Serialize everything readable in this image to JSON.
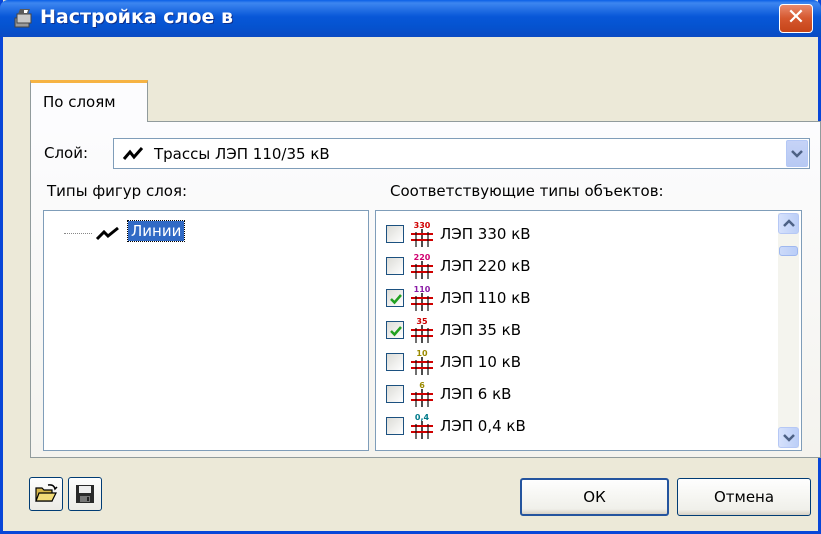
{
  "window": {
    "title": "Настройка слое в",
    "close_symbol": "✕",
    "title_bar_color": "#0a5fe6"
  },
  "tabs": [
    {
      "label": "По слоям",
      "active": true
    }
  ],
  "layer": {
    "label": "Слой:",
    "value": "Трассы ЛЭП 110/35 кВ"
  },
  "shape_types": {
    "heading": "Типы фигур слоя:",
    "items": [
      {
        "label": "Линии",
        "selected": true
      }
    ]
  },
  "object_types": {
    "heading": "Соответствующие типы объектов:",
    "items": [
      {
        "label": "ЛЭП 330 кВ",
        "voltage": "330",
        "color": "#d00000",
        "checked": false
      },
      {
        "label": "ЛЭП 220 кВ",
        "voltage": "220",
        "color": "#d00070",
        "checked": false
      },
      {
        "label": "ЛЭП 110 кВ",
        "voltage": "110",
        "color": "#8a1aa6",
        "checked": true
      },
      {
        "label": "ЛЭП 35 кВ",
        "voltage": "35",
        "color": "#cc0000",
        "checked": true
      },
      {
        "label": "ЛЭП 10 кВ",
        "voltage": "10",
        "color": "#9a8a00",
        "checked": false
      },
      {
        "label": "ЛЭП 6 кВ",
        "voltage": "6",
        "color": "#9a8a00",
        "checked": false
      },
      {
        "label": "ЛЭП 0,4 кВ",
        "voltage": "0,4",
        "color": "#007a8a",
        "checked": false
      }
    ]
  },
  "buttons": {
    "ok": "ОК",
    "cancel": "Отмена"
  },
  "toolbar": {
    "open_icon": "folder-open-icon",
    "save_icon": "floppy-disk-icon"
  }
}
